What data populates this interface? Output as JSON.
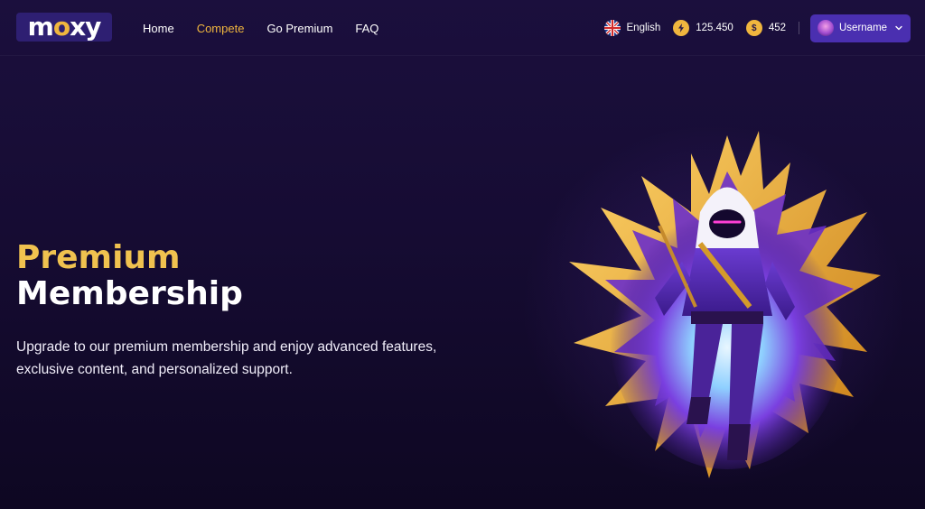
{
  "header": {
    "logo_text": "moxy",
    "nav": [
      {
        "label": "Home",
        "active": false
      },
      {
        "label": "Compete",
        "active": true
      },
      {
        "label": "Go Premium",
        "active": false
      },
      {
        "label": "FAQ",
        "active": false
      }
    ],
    "language": "English",
    "coins_balance": "125.450",
    "cash_balance": "452",
    "cash_symbol": "$",
    "username": "Username"
  },
  "hero": {
    "title_line1": "Premium",
    "title_line2": "Membership",
    "description": "Upgrade to our premium membership and enjoy advanced features, exclusive content, and personalized support."
  },
  "colors": {
    "background": "#1b0f3d",
    "accent_gold": "#f0b63e",
    "button_purple": "#4a2fb0"
  },
  "icons": {
    "language_flag": "uk-flag-icon",
    "coins": "bolt-coin-icon",
    "cash": "dollar-coin-icon",
    "dropdown": "chevron-down-icon"
  }
}
